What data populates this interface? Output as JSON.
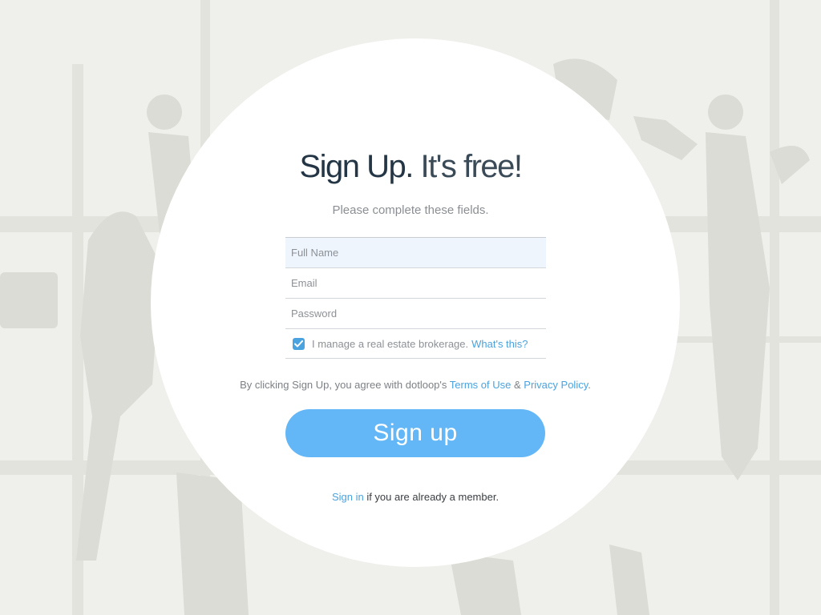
{
  "header": {
    "title_strong": "Sign Up.",
    "title_light": "It's free!",
    "subtitle": "Please complete these fields."
  },
  "form": {
    "full_name": {
      "placeholder": "Full Name",
      "value": ""
    },
    "email": {
      "placeholder": "Email",
      "value": ""
    },
    "password": {
      "placeholder": "Password",
      "value": ""
    },
    "brokerage": {
      "checked": true,
      "label": "I manage a real estate brokerage.",
      "help_link": "What's this?"
    }
  },
  "terms": {
    "prefix": "By clicking Sign Up, you agree with dotloop's",
    "terms_link": "Terms of Use",
    "separator": "&",
    "privacy_link": "Privacy Policy",
    "suffix": "."
  },
  "signup_button": {
    "label": "Sign up"
  },
  "signin": {
    "link": "Sign in",
    "text": "if you are already a member."
  },
  "colors": {
    "accent": "#4aa3df",
    "button": "#63b7f7",
    "heading": "#243645",
    "background": "#efefeb",
    "field_active": "#eef5fd"
  }
}
